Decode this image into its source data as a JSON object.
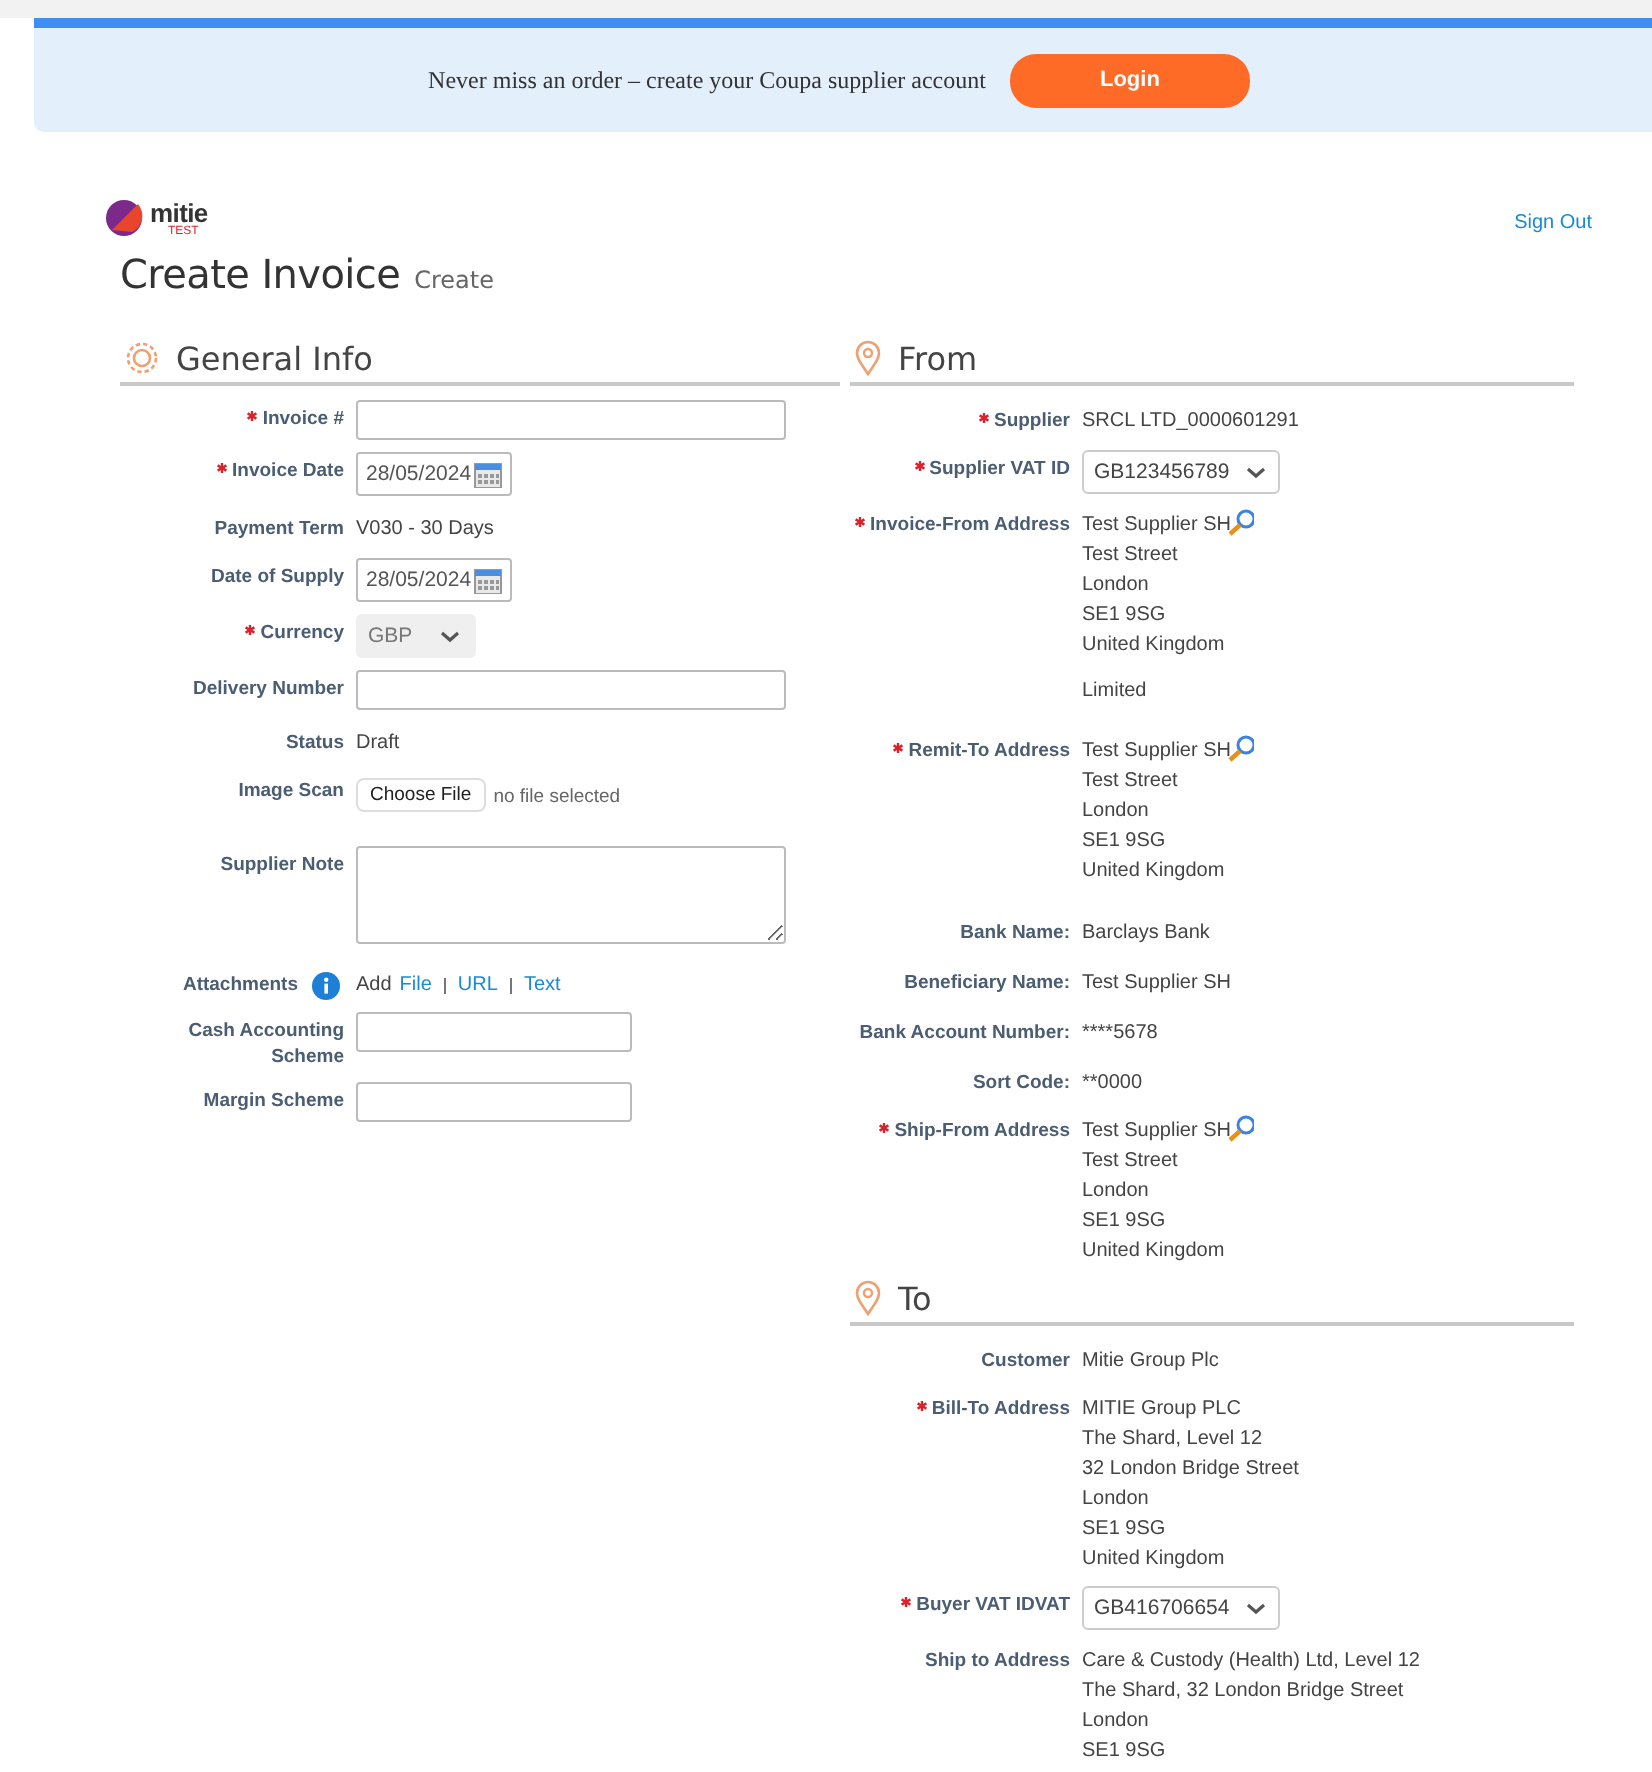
{
  "banner": {
    "message": "Never miss an order – create your Coupa supplier account",
    "button": "Login"
  },
  "header": {
    "logo_text": "mitie",
    "logo_sub": "TEST",
    "sign_out": "Sign Out",
    "title": "Create Invoice",
    "subtitle": "Create"
  },
  "general_info": {
    "title": "General Info",
    "fields": [
      {
        "kind": "input",
        "label": "Invoice #",
        "required": true
      },
      {
        "kind": "date",
        "label": "Invoice Date",
        "required": true,
        "value": "28/05/2024"
      },
      {
        "kind": "text",
        "label": "Payment Term",
        "required": false,
        "value": "V030 - 30 Days"
      },
      {
        "kind": "date",
        "label": "Date of Supply",
        "required": false,
        "value": "28/05/2024"
      },
      {
        "kind": "select",
        "label": "Currency",
        "required": true,
        "value": "GBP",
        "disabled": true
      },
      {
        "kind": "input",
        "label": "Delivery Number",
        "required": false
      },
      {
        "kind": "text",
        "label": "Status",
        "required": false,
        "value": "Draft"
      },
      {
        "kind": "file",
        "label": "Image Scan",
        "required": false,
        "button": "Choose File",
        "value": "no file selected"
      },
      {
        "kind": "textarea",
        "label": "Supplier Note",
        "required": false
      },
      {
        "kind": "attachments",
        "label": "Attachments",
        "required": false,
        "value": "Add",
        "links": [
          "File",
          "URL",
          "Text"
        ]
      },
      {
        "kind": "short_input",
        "label": "Cash Accounting Scheme",
        "required": false
      },
      {
        "kind": "short_input",
        "label": "Margin Scheme",
        "required": false
      }
    ]
  },
  "from": {
    "title": "From",
    "fields": [
      {
        "kind": "text",
        "label": "Supplier",
        "required": true,
        "value": "SRCL LTD_0000601291"
      },
      {
        "kind": "select",
        "label": "Supplier VAT ID",
        "required": true,
        "value": "GB123456789",
        "disabled": false
      },
      {
        "kind": "address",
        "label": "Invoice-From Address",
        "required": true,
        "lines": [
          "Test Supplier SH",
          "Test Street",
          "London",
          "SE1 9SG",
          "United Kingdom"
        ],
        "note": "Limited",
        "lookup": true
      },
      {
        "kind": "address",
        "label": "Remit-To Address",
        "required": true,
        "lines": [
          "Test Supplier SH",
          "Test Street",
          "London",
          "SE1 9SG",
          "United Kingdom"
        ],
        "lookup": true
      },
      {
        "kind": "text",
        "label": "Bank Name:",
        "required": false,
        "value": "Barclays Bank"
      },
      {
        "kind": "text",
        "label": "Beneficiary Name:",
        "required": false,
        "value": "Test Supplier SH"
      },
      {
        "kind": "text",
        "label": "Bank Account Number:",
        "required": false,
        "value": "****5678"
      },
      {
        "kind": "text",
        "label": "Sort Code:",
        "required": false,
        "value": "**0000"
      },
      {
        "kind": "address",
        "label": "Ship-From Address",
        "required": true,
        "lines": [
          "Test Supplier SH",
          "Test Street",
          "London",
          "SE1 9SG",
          "United Kingdom"
        ],
        "lookup": true
      }
    ]
  },
  "to": {
    "title": "To",
    "fields": [
      {
        "kind": "text",
        "label": "Customer",
        "required": false,
        "value": "Mitie Group Plc"
      },
      {
        "kind": "address",
        "label": "Bill-To Address",
        "required": true,
        "lines": [
          "MITIE Group PLC",
          "The Shard, Level 12",
          "32 London Bridge Street",
          "London",
          "SE1 9SG",
          "United Kingdom"
        ],
        "lookup": false
      },
      {
        "kind": "select",
        "label": "Buyer VAT IDVAT",
        "required": true,
        "value": "GB416706654",
        "disabled": false
      },
      {
        "kind": "address",
        "label": "Ship to Address",
        "required": false,
        "lines": [
          "Care & Custody (Health) Ltd, Level 12",
          "The Shard, 32 London Bridge Street",
          "London",
          "SE1 9SG"
        ],
        "lookup": false
      }
    ]
  }
}
